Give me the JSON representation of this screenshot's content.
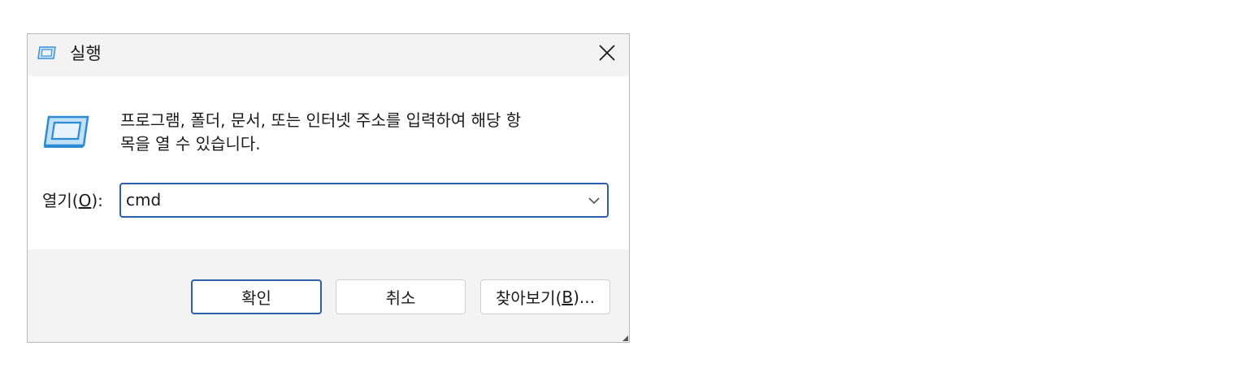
{
  "window": {
    "title": "실행",
    "close_icon": "close-icon",
    "title_icon": "run-app-icon"
  },
  "content": {
    "app_icon": "run-app-icon",
    "description_line1": "프로그램, 폴더, 문서, 또는 인터넷 주소를 입력하여 해당 항",
    "description_line2": "목을 열 수 있습니다.",
    "open_label_prefix": "열기(",
    "open_label_mnemonic": "O",
    "open_label_suffix": "):",
    "input_value": "cmd",
    "dropdown_icon": "chevron-down-icon"
  },
  "buttons": {
    "ok_label": "확인",
    "cancel_label": "취소",
    "browse_prefix": "찾아보기(",
    "browse_mnemonic": "B",
    "browse_suffix": ")..."
  },
  "colors": {
    "accent": "#2d5fa8",
    "icon_blue": "#5aa9e6"
  }
}
